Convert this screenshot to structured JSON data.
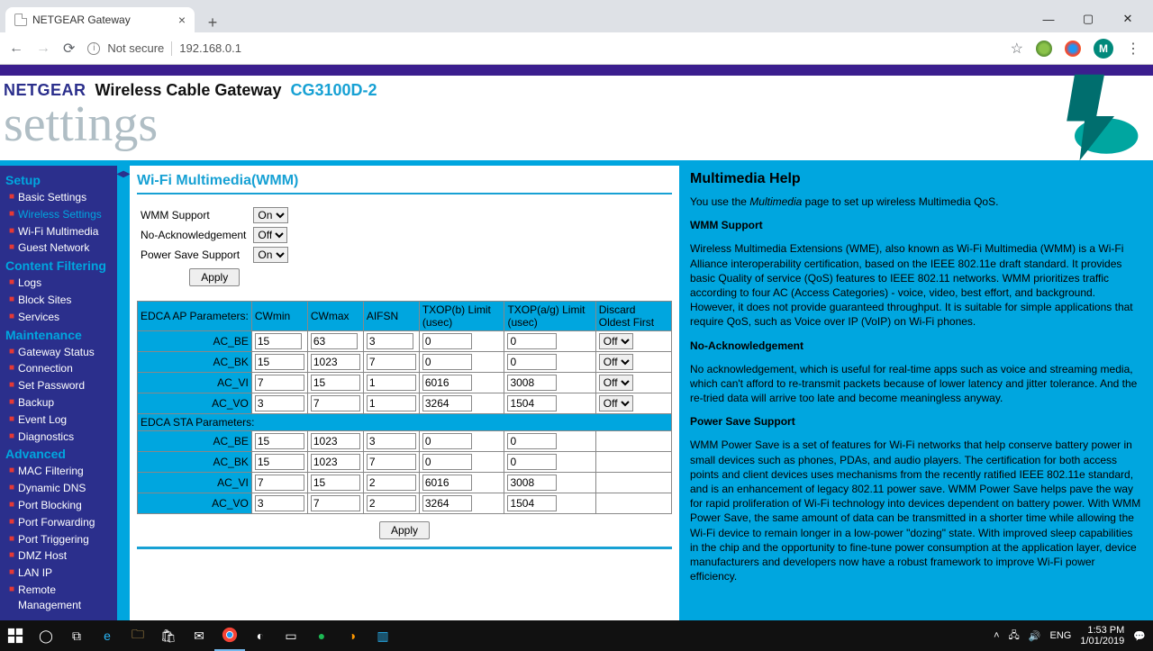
{
  "browser": {
    "tab_title": "NETGEAR Gateway",
    "not_secure": "Not secure",
    "url": "192.168.0.1",
    "avatar_letter": "M"
  },
  "header": {
    "brand": "NETGEAR",
    "product": "Wireless Cable Gateway",
    "model": "CG3100D-2",
    "settings_word": "settings"
  },
  "nav": {
    "sections": {
      "setup": "Setup",
      "content": "Content Filtering",
      "maint": "Maintenance",
      "advanced": "Advanced"
    },
    "items": {
      "basic": "Basic Settings",
      "wireless": "Wireless Settings",
      "wmm": "Wi-Fi Multimedia",
      "guest": "Guest Network",
      "logs": "Logs",
      "block": "Block Sites",
      "services": "Services",
      "gateway": "Gateway Status",
      "connection": "Connection",
      "password": "Set Password",
      "backup": "Backup",
      "event": "Event Log",
      "diag": "Diagnostics",
      "mac": "MAC Filtering",
      "ddns": "Dynamic DNS",
      "portblock": "Port Blocking",
      "portfwd": "Port Forwarding",
      "porttrig": "Port Triggering",
      "dmz": "DMZ Host",
      "lanip": "LAN IP",
      "remote": "Remote Management"
    }
  },
  "page": {
    "title": "Wi-Fi Multimedia(WMM)",
    "labels": {
      "wmm_support": "WMM Support",
      "no_ack": "No-Acknowledgement",
      "power_save": "Power Save Support"
    },
    "selects": {
      "wmm_support": "On",
      "no_ack": "Off",
      "power_save": "On"
    },
    "buttons": {
      "apply": "Apply"
    },
    "edca": {
      "ap_header": "EDCA AP Parameters:",
      "sta_header": "EDCA STA Parameters:",
      "cols": {
        "cwmin": "CWmin",
        "cwmax": "CWmax",
        "aifsn": "AIFSN",
        "txopb": "TXOP(b) Limit (usec)",
        "txopag": "TXOP(a/g) Limit (usec)",
        "discard": "Discard Oldest First"
      },
      "rows_label": {
        "be": "AC_BE",
        "bk": "AC_BK",
        "vi": "AC_VI",
        "vo": "AC_VO"
      },
      "ap": {
        "be": {
          "cwmin": "15",
          "cwmax": "63",
          "aifsn": "3",
          "txopb": "0",
          "txopag": "0",
          "discard": "Off"
        },
        "bk": {
          "cwmin": "15",
          "cwmax": "1023",
          "aifsn": "7",
          "txopb": "0",
          "txopag": "0",
          "discard": "Off"
        },
        "vi": {
          "cwmin": "7",
          "cwmax": "15",
          "aifsn": "1",
          "txopb": "6016",
          "txopag": "3008",
          "discard": "Off"
        },
        "vo": {
          "cwmin": "3",
          "cwmax": "7",
          "aifsn": "1",
          "txopb": "3264",
          "txopag": "1504",
          "discard": "Off"
        }
      },
      "sta": {
        "be": {
          "cwmin": "15",
          "cwmax": "1023",
          "aifsn": "3",
          "txopb": "0",
          "txopag": "0"
        },
        "bk": {
          "cwmin": "15",
          "cwmax": "1023",
          "aifsn": "7",
          "txopb": "0",
          "txopag": "0"
        },
        "vi": {
          "cwmin": "7",
          "cwmax": "15",
          "aifsn": "2",
          "txopb": "6016",
          "txopag": "3008"
        },
        "vo": {
          "cwmin": "3",
          "cwmax": "7",
          "aifsn": "2",
          "txopb": "3264",
          "txopag": "1504"
        }
      }
    }
  },
  "help": {
    "title": "Multimedia Help",
    "intro_a": "You use the ",
    "intro_i": "Multimedia",
    "intro_b": " page to set up wireless Multimedia QoS.",
    "h_wmm": "WMM Support",
    "p_wmm": "Wireless Multimedia Extensions (WME), also known as Wi-Fi Multimedia (WMM) is a Wi-Fi Alliance interoperability certification, based on the IEEE 802.11e draft standard. It provides basic Quality of service (QoS) features to IEEE 802.11 networks. WMM prioritizes traffic according to four AC (Access Categories) - voice, video, best effort, and background. However, it does not provide guaranteed throughput. It is suitable for simple applications that require QoS, such as Voice over IP (VoIP) on Wi-Fi phones.",
    "h_noack": "No-Acknowledgement",
    "p_noack": "No acknowledgement, which is useful for real-time apps such as voice and streaming media, which can't afford to re-transmit packets because of lower latency and jitter tolerance. And the re-tried data will arrive too late and become meaningless anyway.",
    "h_ps": "Power Save Support",
    "p_ps": "WMM Power Save is a set of features for Wi-Fi networks that help conserve battery power in small devices such as phones, PDAs, and audio players. The certification for both access points and client devices uses mechanisms from the recently ratified IEEE 802.11e standard, and is an enhancement of legacy 802.11 power save. WMM Power Save helps pave the way for rapid proliferation of Wi-Fi technology into devices dependent on battery power. With WMM Power Save, the same amount of data can be transmitted in a shorter time while allowing the Wi-Fi device to remain longer in a low-power \"dozing\" state. With improved sleep capabilities in the chip and the opportunity to fine-tune power consumption at the application layer, device manufacturers and developers now have a robust framework to improve Wi-Fi power efficiency."
  },
  "taskbar": {
    "lang": "ENG",
    "time": "1:53 PM",
    "date": "1/01/2019"
  }
}
